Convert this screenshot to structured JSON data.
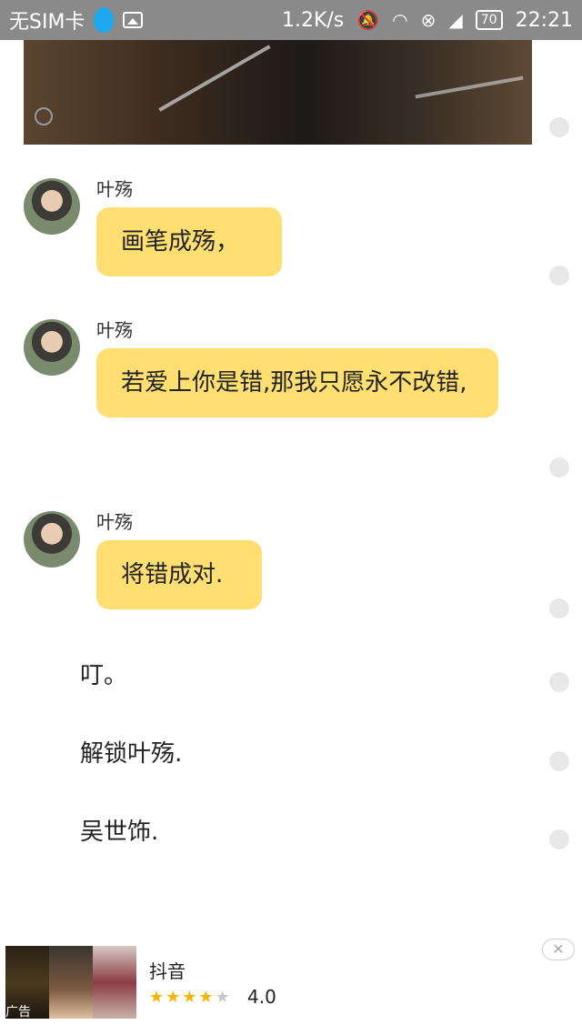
{
  "status_bar": {
    "sim": "无SIM卡",
    "speed": "1.2K/s",
    "battery": "70",
    "time": "22:21",
    "icons": [
      "qq-icon",
      "gallery-icon",
      "mute-icon",
      "wifi-icon",
      "data-icon",
      "signal-icon"
    ]
  },
  "chat": {
    "messages": [
      {
        "name": "叶殇",
        "text": "画笔成殇，"
      },
      {
        "name": "叶殇",
        "text": "若爱上你是错,那我只愿永不改错,"
      },
      {
        "name": "叶殇",
        "text": "将错成对."
      }
    ],
    "plain_lines": [
      "叮。",
      "解锁叶殇.",
      "吴世饰."
    ]
  },
  "ad": {
    "label": "广告",
    "app_name": "抖音",
    "rating": "4.0",
    "stars": "★★★★",
    "empty_star": "★",
    "close": "✕"
  },
  "colors": {
    "bubble": "#ffdf72",
    "status_bar": "#8a8a8a",
    "star": "#f5b400"
  }
}
